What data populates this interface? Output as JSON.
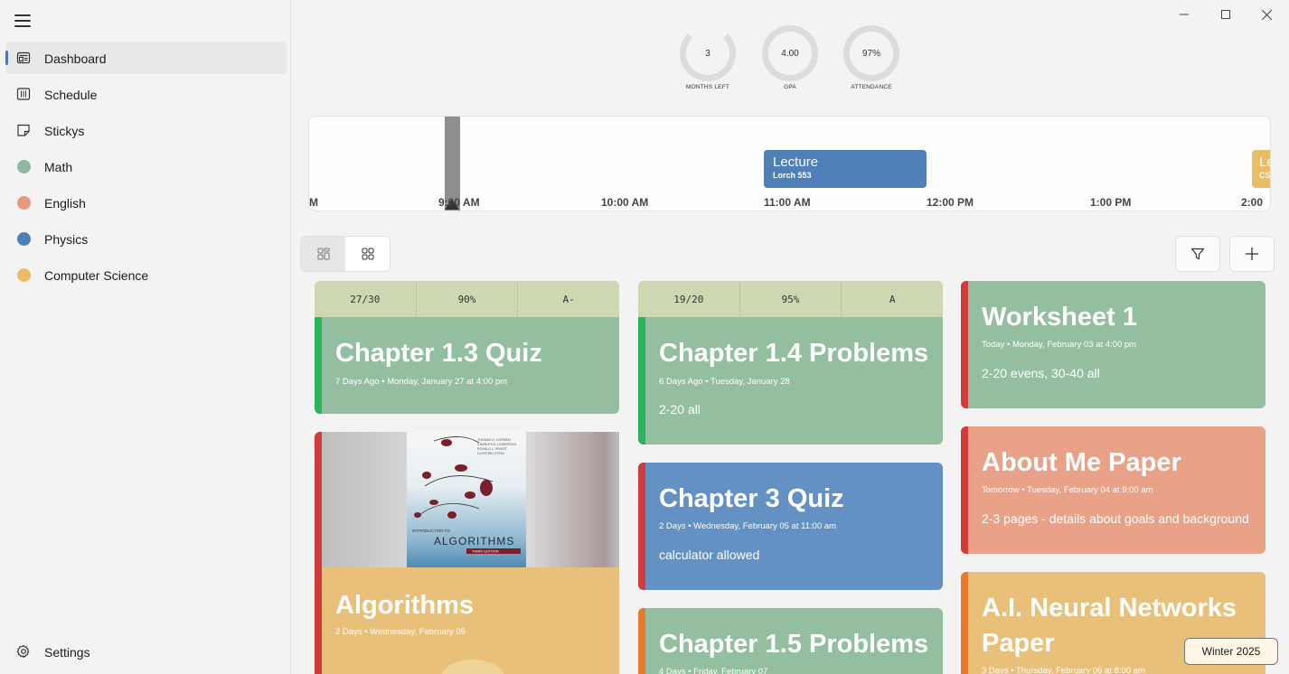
{
  "sidebar": {
    "items": [
      {
        "label": "Dashboard",
        "icon": "dashboard-icon"
      },
      {
        "label": "Schedule",
        "icon": "calendar-icon"
      },
      {
        "label": "Stickys",
        "icon": "sticky-note-icon"
      },
      {
        "label": "Math",
        "color": "#8fb8a0"
      },
      {
        "label": "English",
        "color": "#e89a7e"
      },
      {
        "label": "Physics",
        "color": "#4e7fb8"
      },
      {
        "label": "Computer Science",
        "color": "#e8bd63"
      }
    ],
    "settings_label": "Settings"
  },
  "stats": [
    {
      "value": "3",
      "label": "MONTHS LEFT"
    },
    {
      "value": "4.00",
      "label": "GPA"
    },
    {
      "value": "97%",
      "label": "ATTENDANCE"
    }
  ],
  "timeline": {
    "ticks": [
      "M",
      "9:00 AM",
      "10:00 AM",
      "11:00 AM",
      "12:00 PM",
      "1:00 PM",
      "2:00"
    ],
    "events": [
      {
        "title": "Lecture",
        "subtitle": "Lorch 553",
        "color": "#4e7fb8"
      },
      {
        "title": "Le",
        "subtitle": "CS",
        "color": "#e8bd63"
      }
    ]
  },
  "cards": [
    {
      "title": "Chapter 1.3 Quiz",
      "meta": "7 Days Ago • Monday, January 27 at 4:00 pm",
      "desc": "",
      "scores": [
        "27/30",
        "90%",
        "A-"
      ],
      "bg": "#94bea0",
      "stripe": "#2bb55a"
    },
    {
      "title": "Algorithms",
      "meta": "2 Days • Wednesday, February 05",
      "desc": "",
      "bg": "#e8c07a",
      "stripe": "#d13b3b"
    },
    {
      "title": "Chapter 1.4 Problems",
      "meta": "6 Days Ago • Tuesday, January 28",
      "desc": "2-20 all",
      "scores": [
        "19/20",
        "95%",
        "A"
      ],
      "bg": "#94bea0",
      "stripe": "#2bb55a"
    },
    {
      "title": "Chapter 3 Quiz",
      "meta": "2 Days • Wednesday, February 05 at 11:00 am",
      "desc": "calculator allowed",
      "bg": "#6391c4",
      "stripe": "#d13b3b"
    },
    {
      "title": "Chapter 1.5 Problems",
      "meta": "4 Days • Friday, February 07",
      "desc": "",
      "bg": "#94bea0",
      "stripe": "#e87b2a"
    },
    {
      "title": "Worksheet 1",
      "meta": "Today • Monday, February 03 at 4:00 pm",
      "desc": "2-20 evens, 30-40 all",
      "bg": "#94bea0",
      "stripe": "#d13b3b"
    },
    {
      "title": "About Me Paper",
      "meta": "Tomorrow • Tuesday, February 04 at 9:00 am",
      "desc": "2-3 pages - details about goals and background",
      "bg": "#e9a187",
      "stripe": "#d13b3b"
    },
    {
      "title": "A.I. Neural Networks",
      "title2": "Paper",
      "meta": "3 Days • Thursday, February 06 at 8:00 am",
      "desc": "",
      "bg": "#e8c07a",
      "stripe": "#e87b2a"
    }
  ],
  "term_badge": "Winter 2025",
  "book_cover": {
    "authors": "THOMAS H. CORMEN\nCHARLES E. LEISERSON\nRONALD L. RIVEST\nCLIFFORD STEIN",
    "subtitle": "INTRODUCTION TO",
    "title": "ALGORITHMS",
    "edition": "THIRD EDITION"
  }
}
